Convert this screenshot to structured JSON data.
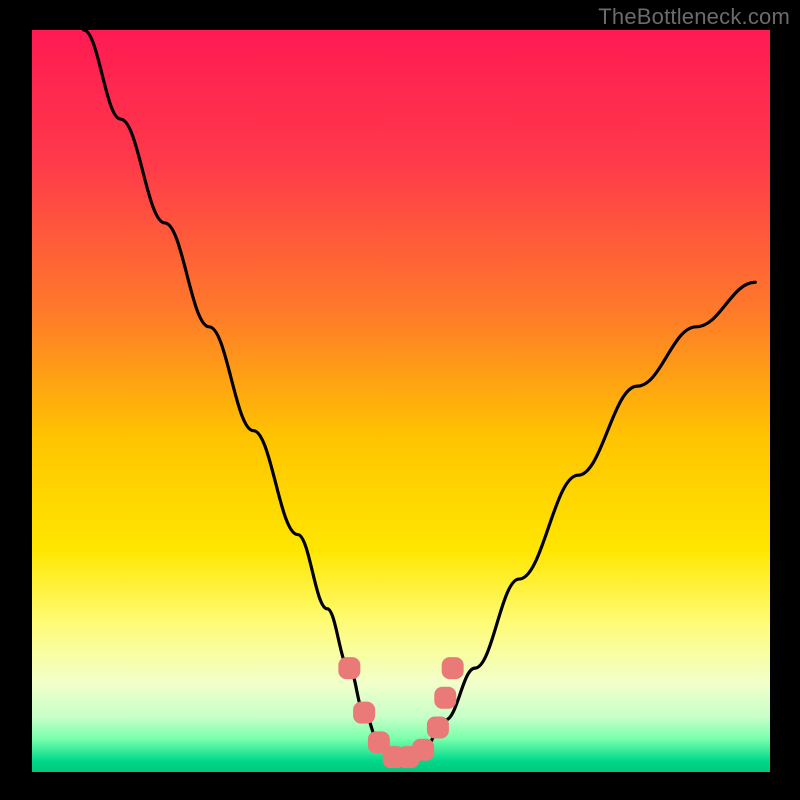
{
  "watermark": "TheBottleneck.com",
  "colors": {
    "frame": "#000000",
    "watermark": "#6b6b6b",
    "gradient_top": "#ff1a52",
    "gradient_mid_upper": "#ff6a2a",
    "gradient_mid": "#ffe600",
    "gradient_lower": "#f6ffb0",
    "gradient_green_light": "#9cff9c",
    "gradient_green": "#00e07a",
    "curve": "#000000",
    "marker": "#e97a78"
  },
  "chart_data": {
    "type": "line",
    "title": "",
    "xlabel": "",
    "ylabel": "",
    "xlim": [
      0,
      100
    ],
    "ylim": [
      0,
      100
    ],
    "series": [
      {
        "name": "bottleneck-curve",
        "x": [
          7,
          12,
          18,
          24,
          30,
          36,
          40,
          43,
          45,
          47,
          50,
          53,
          56,
          60,
          66,
          74,
          82,
          90,
          98
        ],
        "y": [
          100,
          88,
          74,
          60,
          46,
          32,
          22,
          14,
          8,
          4,
          2,
          3,
          7,
          14,
          26,
          40,
          52,
          60,
          66
        ]
      }
    ],
    "markers": {
      "name": "optimal-range",
      "x": [
        43,
        45,
        47,
        49,
        51,
        53,
        55,
        56,
        57
      ],
      "y": [
        14,
        8,
        4,
        2,
        2,
        3,
        6,
        10,
        14
      ]
    },
    "annotations": []
  }
}
